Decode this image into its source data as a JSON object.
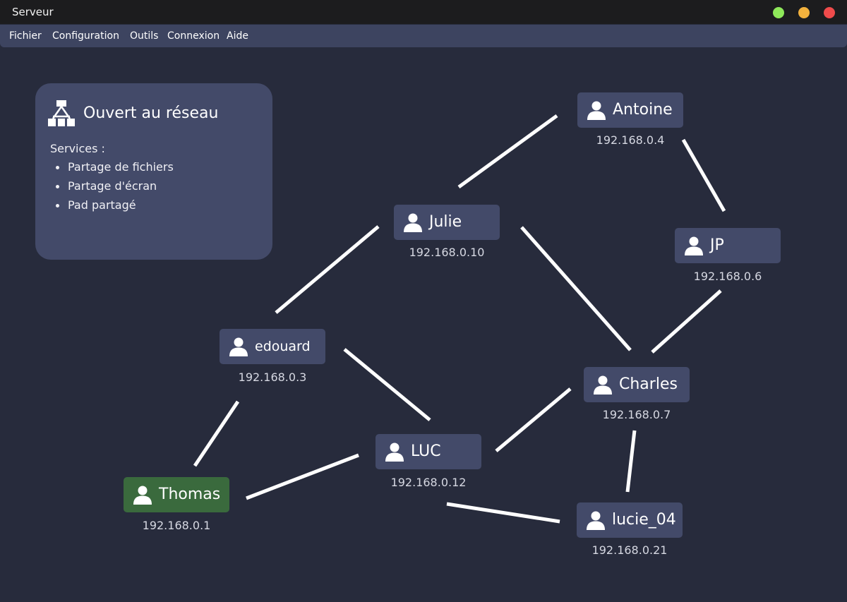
{
  "window": {
    "title": "Serveur",
    "controls": [
      {
        "name": "maximize",
        "color": "#8ee85a"
      },
      {
        "name": "minimize",
        "color": "#f2b13d"
      },
      {
        "name": "close",
        "color": "#ef4b4b"
      }
    ]
  },
  "menu": {
    "items": [
      "Fichier",
      "Configuration",
      "Outils",
      "Connexion",
      "Aide"
    ]
  },
  "status_panel": {
    "icon": "network-icon",
    "title": "Ouvert au réseau",
    "services_label": "Services :",
    "services": [
      "Partage de fichiers",
      "Partage d'écran",
      "Pad partagé"
    ]
  },
  "nodes": [
    {
      "id": "antoine",
      "name": "Antoine",
      "ip": "192.168.0.4",
      "icon": "user-icon"
    },
    {
      "id": "julie",
      "name": "Julie",
      "ip": "192.168.0.10",
      "icon": "user-icon"
    },
    {
      "id": "jp",
      "name": "JP",
      "ip": "192.168.0.6",
      "icon": "user-icon"
    },
    {
      "id": "edouard",
      "name": "edouard",
      "ip": "192.168.0.3",
      "icon": "user-icon"
    },
    {
      "id": "charles",
      "name": "Charles",
      "ip": "192.168.0.7",
      "icon": "user-icon"
    },
    {
      "id": "luc",
      "name": "LUC",
      "ip": "192.168.0.12",
      "icon": "user-icon"
    },
    {
      "id": "thomas",
      "name": "Thomas",
      "ip": "192.168.0.1",
      "icon": "user-icon",
      "local": true
    },
    {
      "id": "lucie",
      "name": "lucie_04",
      "ip": "192.168.0.21",
      "icon": "user-icon"
    }
  ],
  "connections": [
    [
      "julie",
      "antoine"
    ],
    [
      "antoine",
      "jp"
    ],
    [
      "julie",
      "edouard"
    ],
    [
      "julie",
      "charles"
    ],
    [
      "jp",
      "charles"
    ],
    [
      "edouard",
      "luc"
    ],
    [
      "edouard",
      "thomas"
    ],
    [
      "thomas",
      "luc"
    ],
    [
      "luc",
      "charles"
    ],
    [
      "charles",
      "lucie"
    ],
    [
      "luc",
      "lucie"
    ]
  ],
  "colors": {
    "background": "#272b3c",
    "node": "#434a69",
    "local_node": "#3a6a3d",
    "edge": "#ffffff"
  }
}
